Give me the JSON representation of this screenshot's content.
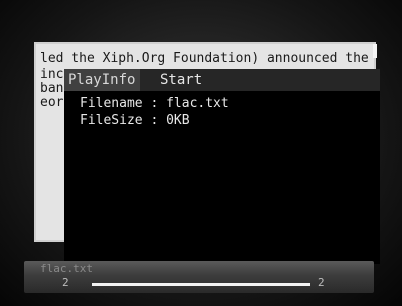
{
  "document": {
    "lines": [
      "led the Xiph.Org Foundation) announced the",
      "inc",
      "ban",
      "eor"
    ]
  },
  "popup": {
    "title": "PlayInfo",
    "action": "Start",
    "filename_label": "Filename : flac.txt",
    "filesize_label": "FileSize : 0KB"
  },
  "statusbar": {
    "filename": "flac.txt",
    "current_page": "2",
    "total_pages": "2",
    "progress": 1.0
  },
  "colors": {
    "popup_bg": "#000000",
    "page_bg": "#e4e4e4",
    "progress": "#f2f2f2"
  }
}
